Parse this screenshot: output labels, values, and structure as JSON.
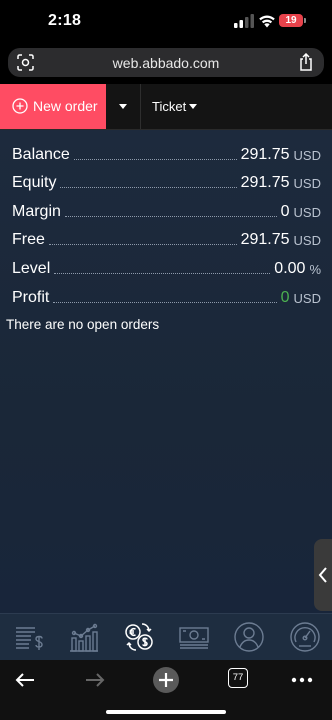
{
  "status_bar": {
    "time": "2:18",
    "battery": "19"
  },
  "browser": {
    "url": "web.abbado.com",
    "tabs_count": "77"
  },
  "toolbar": {
    "new_order_label": "New order",
    "ticket_label": "Ticket"
  },
  "account": {
    "rows": [
      {
        "label": "Balance",
        "value": "291.75",
        "unit": "USD"
      },
      {
        "label": "Equity",
        "value": "291.75",
        "unit": "USD"
      },
      {
        "label": "Margin",
        "value": "0",
        "unit": "USD"
      },
      {
        "label": "Free",
        "value": "291.75",
        "unit": "USD"
      },
      {
        "label": "Level",
        "value": "0.00",
        "unit": "%"
      },
      {
        "label": "Profit",
        "value": "0",
        "unit": "USD"
      }
    ],
    "empty_message": "There are no open orders"
  },
  "nav_icons": [
    "orders-list-icon",
    "chart-icon",
    "currency-exchange-icon",
    "banknote-icon",
    "account-icon",
    "speedometer-icon"
  ],
  "colors": {
    "accent": "#ff4c63",
    "panel": "#1d2a3d",
    "profit_green": "#4caf50"
  }
}
